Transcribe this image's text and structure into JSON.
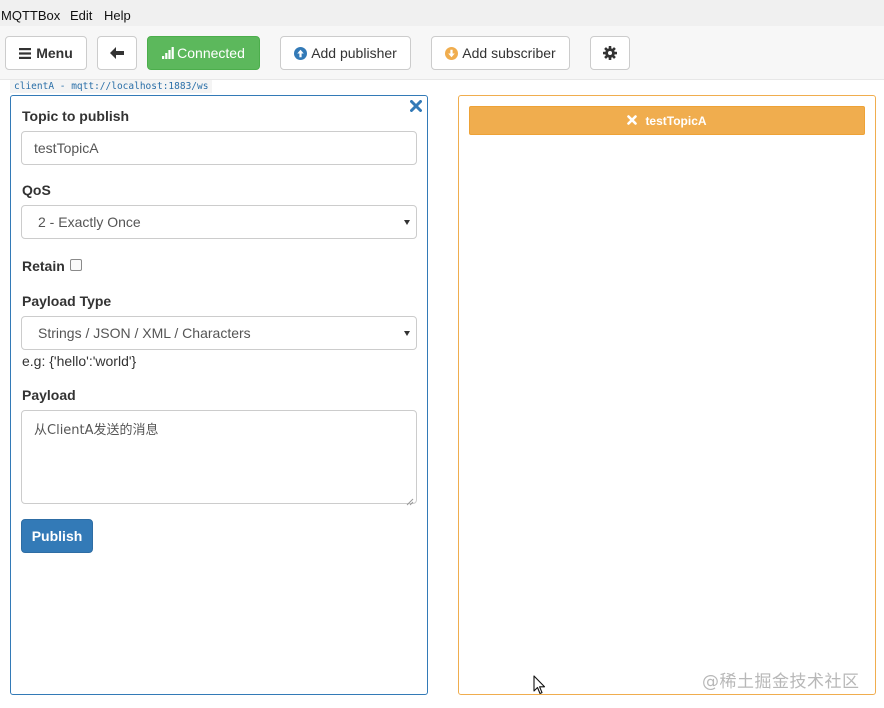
{
  "menubar": {
    "items": [
      "MQTTBox",
      "Edit",
      "Help"
    ]
  },
  "toolbar": {
    "menu_label": "Menu",
    "connected_label": "Connected",
    "add_publisher_label": "Add publisher",
    "add_subscriber_label": "Add subscriber"
  },
  "client_label": "clientA - mqtt://localhost:1883/ws",
  "publisher": {
    "topic_label": "Topic to publish",
    "topic_value": "testTopicA",
    "qos_label": "QoS",
    "qos_value": "2 - Exactly Once",
    "retain_label": "Retain",
    "payload_type_label": "Payload Type",
    "payload_type_value": "Strings / JSON / XML / Characters",
    "payload_hint": "e.g: {'hello':'world'}",
    "payload_label": "Payload",
    "payload_value": "从ClientA发送的消息",
    "publish_label": "Publish"
  },
  "subscriber": {
    "topic": "testTopicA"
  },
  "watermark": "@稀土掘金技术社区",
  "colors": {
    "primary": "#337ab7",
    "success": "#5cb85c",
    "warning": "#f0ad4e"
  },
  "icons": {
    "menu": "bars-icon",
    "back": "arrow-left-icon",
    "connected": "signal-icon",
    "add_publisher": "arrow-circle-up-icon",
    "add_subscriber": "arrow-circle-down-icon",
    "settings": "gear-icon",
    "close": "close-icon"
  }
}
